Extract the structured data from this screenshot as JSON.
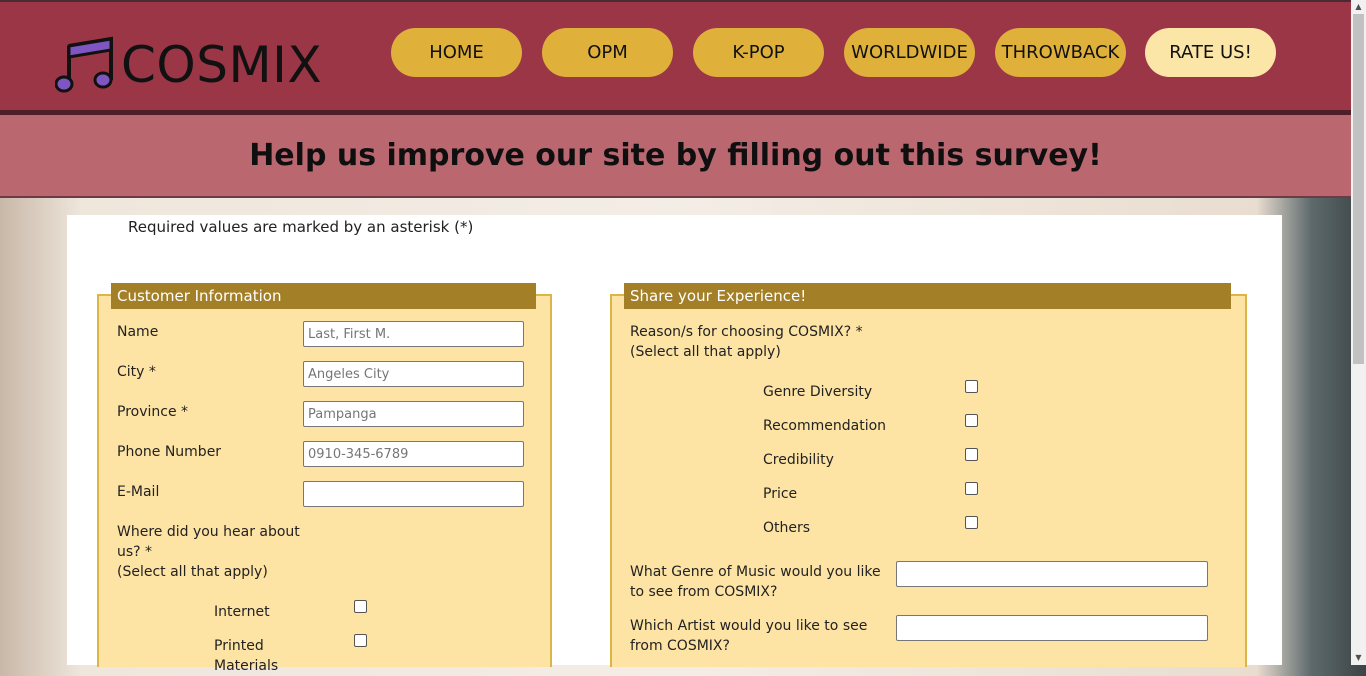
{
  "brand": {
    "name": "COSMIX",
    "logo_icon": "music-note-icon",
    "colors": {
      "primary": "#9b3646",
      "accent": "#dfb03a",
      "active": "#fbe6a8",
      "banner": "#ba6770",
      "legend": "#a37f27",
      "fieldset": "#fde4a4"
    }
  },
  "nav": {
    "home": "HOME",
    "opm": "OPM",
    "kpop": "K-POP",
    "worldwide": "WORLDWIDE",
    "throwback": "THROWBACK",
    "rate": "RATE US!"
  },
  "banner": {
    "title": "Help us improve our site by filling out this survey!"
  },
  "form": {
    "required_note": "Required values are marked by an asterisk (*)",
    "customer": {
      "legend": "Customer Information",
      "name_label": "Name",
      "name_placeholder": "Last, First M.",
      "city_label": "City *",
      "city_placeholder": "Angeles City",
      "province_label": "Province *",
      "province_placeholder": "Pampanga",
      "phone_label": "Phone Number",
      "phone_placeholder": "0910-345-6789",
      "email_label": "E-Mail",
      "hear_label_1": "Where did you hear about",
      "hear_label_2": "us? *",
      "hear_label_3": "(Select all that apply)",
      "hear_options": [
        "Internet",
        "Printed"
      ],
      "hear_partial": "Materials"
    },
    "experience": {
      "legend": "Share your Experience!",
      "reason_label_1": "Reason/s for choosing COSMIX? *",
      "reason_label_2": "(Select all that apply)",
      "reasons": [
        "Genre Diversity",
        "Recommendation",
        "Credibility",
        "Price",
        "Others"
      ],
      "genre_label_1": "What Genre of Music would you like",
      "genre_label_2": "to see from COSMIX?",
      "artist_label_1": "Which Artist would you like to see",
      "artist_label_2": "from COSMIX?"
    }
  }
}
